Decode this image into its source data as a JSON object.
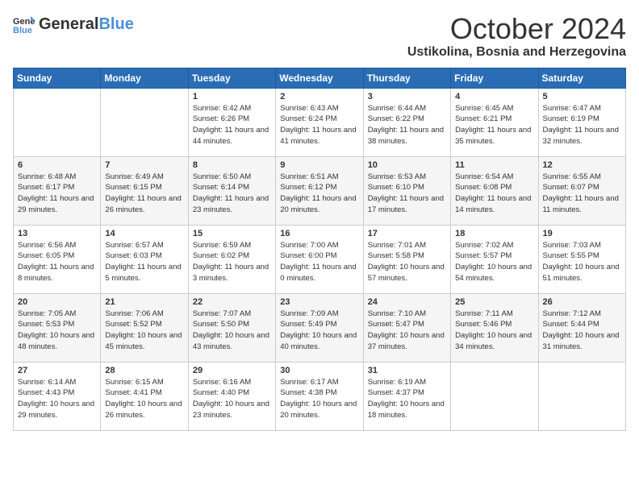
{
  "header": {
    "logo_general": "General",
    "logo_blue": "Blue",
    "month": "October 2024",
    "location": "Ustikolina, Bosnia and Herzegovina"
  },
  "weekdays": [
    "Sunday",
    "Monday",
    "Tuesday",
    "Wednesday",
    "Thursday",
    "Friday",
    "Saturday"
  ],
  "weeks": [
    [
      {
        "day": "",
        "sunrise": "",
        "sunset": "",
        "daylight": ""
      },
      {
        "day": "",
        "sunrise": "",
        "sunset": "",
        "daylight": ""
      },
      {
        "day": "1",
        "sunrise": "Sunrise: 6:42 AM",
        "sunset": "Sunset: 6:26 PM",
        "daylight": "Daylight: 11 hours and 44 minutes."
      },
      {
        "day": "2",
        "sunrise": "Sunrise: 6:43 AM",
        "sunset": "Sunset: 6:24 PM",
        "daylight": "Daylight: 11 hours and 41 minutes."
      },
      {
        "day": "3",
        "sunrise": "Sunrise: 6:44 AM",
        "sunset": "Sunset: 6:22 PM",
        "daylight": "Daylight: 11 hours and 38 minutes."
      },
      {
        "day": "4",
        "sunrise": "Sunrise: 6:45 AM",
        "sunset": "Sunset: 6:21 PM",
        "daylight": "Daylight: 11 hours and 35 minutes."
      },
      {
        "day": "5",
        "sunrise": "Sunrise: 6:47 AM",
        "sunset": "Sunset: 6:19 PM",
        "daylight": "Daylight: 11 hours and 32 minutes."
      }
    ],
    [
      {
        "day": "6",
        "sunrise": "Sunrise: 6:48 AM",
        "sunset": "Sunset: 6:17 PM",
        "daylight": "Daylight: 11 hours and 29 minutes."
      },
      {
        "day": "7",
        "sunrise": "Sunrise: 6:49 AM",
        "sunset": "Sunset: 6:15 PM",
        "daylight": "Daylight: 11 hours and 26 minutes."
      },
      {
        "day": "8",
        "sunrise": "Sunrise: 6:50 AM",
        "sunset": "Sunset: 6:14 PM",
        "daylight": "Daylight: 11 hours and 23 minutes."
      },
      {
        "day": "9",
        "sunrise": "Sunrise: 6:51 AM",
        "sunset": "Sunset: 6:12 PM",
        "daylight": "Daylight: 11 hours and 20 minutes."
      },
      {
        "day": "10",
        "sunrise": "Sunrise: 6:53 AM",
        "sunset": "Sunset: 6:10 PM",
        "daylight": "Daylight: 11 hours and 17 minutes."
      },
      {
        "day": "11",
        "sunrise": "Sunrise: 6:54 AM",
        "sunset": "Sunset: 6:08 PM",
        "daylight": "Daylight: 11 hours and 14 minutes."
      },
      {
        "day": "12",
        "sunrise": "Sunrise: 6:55 AM",
        "sunset": "Sunset: 6:07 PM",
        "daylight": "Daylight: 11 hours and 11 minutes."
      }
    ],
    [
      {
        "day": "13",
        "sunrise": "Sunrise: 6:56 AM",
        "sunset": "Sunset: 6:05 PM",
        "daylight": "Daylight: 11 hours and 8 minutes."
      },
      {
        "day": "14",
        "sunrise": "Sunrise: 6:57 AM",
        "sunset": "Sunset: 6:03 PM",
        "daylight": "Daylight: 11 hours and 5 minutes."
      },
      {
        "day": "15",
        "sunrise": "Sunrise: 6:59 AM",
        "sunset": "Sunset: 6:02 PM",
        "daylight": "Daylight: 11 hours and 3 minutes."
      },
      {
        "day": "16",
        "sunrise": "Sunrise: 7:00 AM",
        "sunset": "Sunset: 6:00 PM",
        "daylight": "Daylight: 11 hours and 0 minutes."
      },
      {
        "day": "17",
        "sunrise": "Sunrise: 7:01 AM",
        "sunset": "Sunset: 5:58 PM",
        "daylight": "Daylight: 10 hours and 57 minutes."
      },
      {
        "day": "18",
        "sunrise": "Sunrise: 7:02 AM",
        "sunset": "Sunset: 5:57 PM",
        "daylight": "Daylight: 10 hours and 54 minutes."
      },
      {
        "day": "19",
        "sunrise": "Sunrise: 7:03 AM",
        "sunset": "Sunset: 5:55 PM",
        "daylight": "Daylight: 10 hours and 51 minutes."
      }
    ],
    [
      {
        "day": "20",
        "sunrise": "Sunrise: 7:05 AM",
        "sunset": "Sunset: 5:53 PM",
        "daylight": "Daylight: 10 hours and 48 minutes."
      },
      {
        "day": "21",
        "sunrise": "Sunrise: 7:06 AM",
        "sunset": "Sunset: 5:52 PM",
        "daylight": "Daylight: 10 hours and 45 minutes."
      },
      {
        "day": "22",
        "sunrise": "Sunrise: 7:07 AM",
        "sunset": "Sunset: 5:50 PM",
        "daylight": "Daylight: 10 hours and 43 minutes."
      },
      {
        "day": "23",
        "sunrise": "Sunrise: 7:09 AM",
        "sunset": "Sunset: 5:49 PM",
        "daylight": "Daylight: 10 hours and 40 minutes."
      },
      {
        "day": "24",
        "sunrise": "Sunrise: 7:10 AM",
        "sunset": "Sunset: 5:47 PM",
        "daylight": "Daylight: 10 hours and 37 minutes."
      },
      {
        "day": "25",
        "sunrise": "Sunrise: 7:11 AM",
        "sunset": "Sunset: 5:46 PM",
        "daylight": "Daylight: 10 hours and 34 minutes."
      },
      {
        "day": "26",
        "sunrise": "Sunrise: 7:12 AM",
        "sunset": "Sunset: 5:44 PM",
        "daylight": "Daylight: 10 hours and 31 minutes."
      }
    ],
    [
      {
        "day": "27",
        "sunrise": "Sunrise: 6:14 AM",
        "sunset": "Sunset: 4:43 PM",
        "daylight": "Daylight: 10 hours and 29 minutes."
      },
      {
        "day": "28",
        "sunrise": "Sunrise: 6:15 AM",
        "sunset": "Sunset: 4:41 PM",
        "daylight": "Daylight: 10 hours and 26 minutes."
      },
      {
        "day": "29",
        "sunrise": "Sunrise: 6:16 AM",
        "sunset": "Sunset: 4:40 PM",
        "daylight": "Daylight: 10 hours and 23 minutes."
      },
      {
        "day": "30",
        "sunrise": "Sunrise: 6:17 AM",
        "sunset": "Sunset: 4:38 PM",
        "daylight": "Daylight: 10 hours and 20 minutes."
      },
      {
        "day": "31",
        "sunrise": "Sunrise: 6:19 AM",
        "sunset": "Sunset: 4:37 PM",
        "daylight": "Daylight: 10 hours and 18 minutes."
      },
      {
        "day": "",
        "sunrise": "",
        "sunset": "",
        "daylight": ""
      },
      {
        "day": "",
        "sunrise": "",
        "sunset": "",
        "daylight": ""
      }
    ]
  ]
}
